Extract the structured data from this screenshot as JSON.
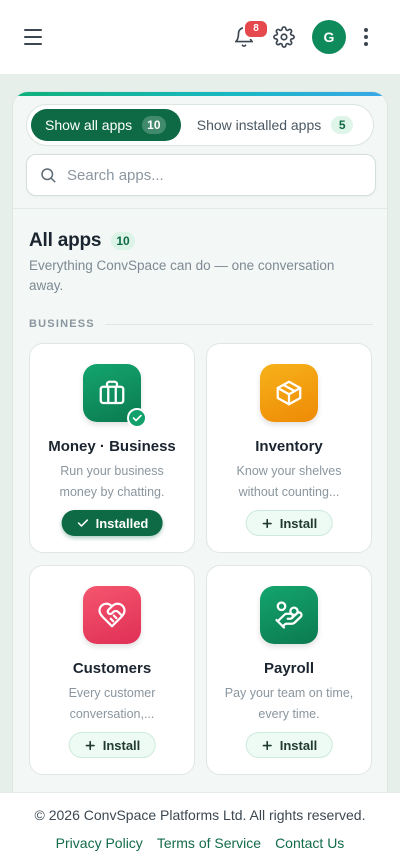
{
  "header": {
    "notifications_count": "8",
    "avatar_initial": "G"
  },
  "toggle": {
    "all_label": "Show all apps",
    "all_count": "10",
    "installed_label": "Show installed apps",
    "installed_count": "5"
  },
  "search": {
    "placeholder": "Search apps..."
  },
  "section": {
    "title": "All apps",
    "count": "10",
    "description": "Everything ConvSpace can do — one conversation away.",
    "group_label": "BUSINESS"
  },
  "apps": [
    {
      "name": "Money · Business",
      "description": "Run your business money by chatting.",
      "action": "Installed",
      "icon": "briefcase-icon",
      "color": "#0e8a5b"
    },
    {
      "name": "Inventory",
      "description": "Know your shelves without counting...",
      "action": "Install",
      "icon": "box-icon",
      "color": "#f29a0b"
    },
    {
      "name": "Customers",
      "description": "Every customer conversation,...",
      "action": "Install",
      "icon": "heart-handshake-icon",
      "color": "#ec4060"
    },
    {
      "name": "Payroll",
      "description": "Pay your team on time, every time.",
      "action": "Install",
      "icon": "hand-coins-icon",
      "color": "#0e8a5b"
    }
  ],
  "footer": {
    "copyright": "© 2026 ConvSpace Platforms Ltd. All rights reserved.",
    "privacy": "Privacy Policy",
    "terms": "Terms of Service",
    "contact": "Contact Us"
  },
  "colors": {
    "brand": "#0d6a45",
    "accent": "#10b07a",
    "danger": "#e5484d"
  }
}
